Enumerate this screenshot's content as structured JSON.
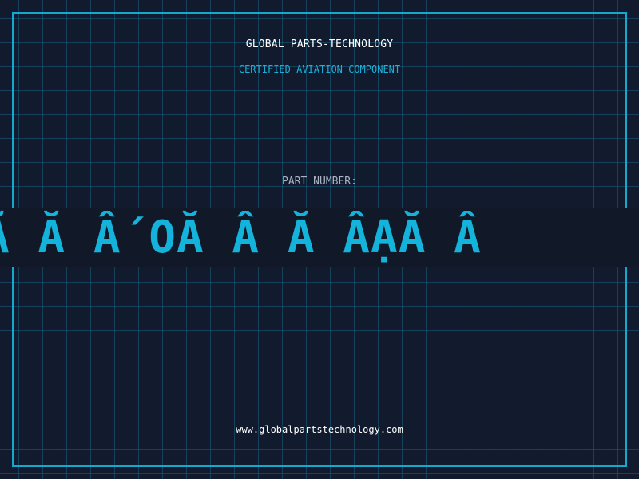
{
  "label": {
    "company": "GLOBAL PARTS-TECHNOLOGY",
    "subtitle": "CERTIFIED AVIATION COMPONENT",
    "part_number_label": "PART NUMBER:",
    "part_number_value": "Ã Ă Â´OĂ Â Ă ÂẠĂ Â",
    "website": "www.globalpartstechnology.com"
  },
  "colors": {
    "background": "#121a2e",
    "accent": "#13b3dc",
    "grid": "#186080"
  }
}
